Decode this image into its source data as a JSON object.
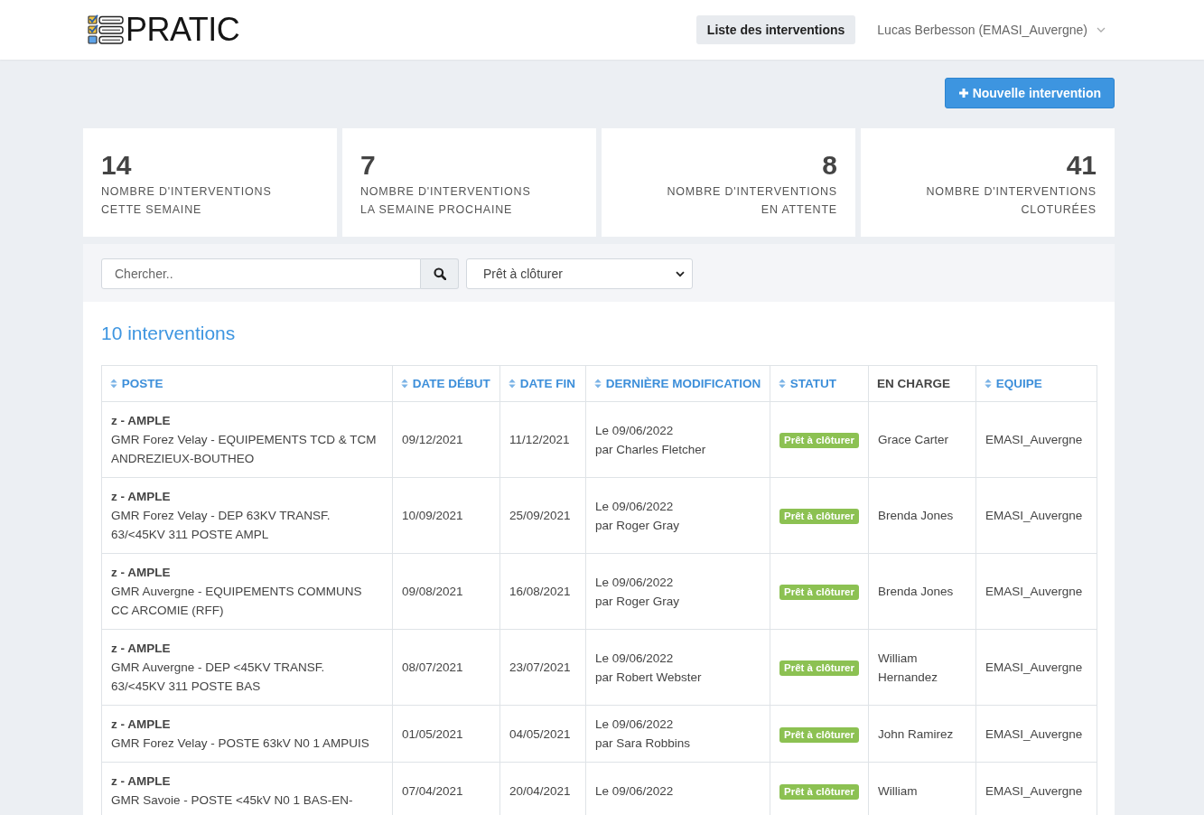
{
  "header": {
    "logo_text": "PRATIC",
    "nav_items": [
      {
        "label": "Liste des interventions",
        "selected": true
      }
    ],
    "user_menu": {
      "label": "Lucas Berbesson (EMASI_Auvergne)"
    }
  },
  "toolbar": {
    "new_button": "Nouvelle intervention"
  },
  "stats": [
    {
      "value": "14",
      "label": "NOMBRE D'INTERVENTIONS\nCETTE SEMAINE"
    },
    {
      "value": "7",
      "label": "NOMBRE D'INTERVENTIONS\nLA SEMAINE PROCHAINE"
    },
    {
      "value": "8",
      "label": "NOMBRE D'INTERVENTIONS\nEN ATTENTE"
    },
    {
      "value": "41",
      "label": "NOMBRE D'INTERVENTIONS\nCLOTURÉES"
    }
  ],
  "filters": {
    "search": {
      "placeholder": "Chercher.."
    },
    "status_select": {
      "value": "Prêt à clôturer"
    }
  },
  "table": {
    "title": "10 interventions",
    "columns": [
      {
        "label": "POSTE",
        "sortable": true
      },
      {
        "label": "DATE DÉBUT",
        "sortable": true
      },
      {
        "label": "DATE FIN",
        "sortable": true
      },
      {
        "label": "DERNIÈRE MODIFICATION",
        "sortable": true
      },
      {
        "label": "STATUT",
        "sortable": true
      },
      {
        "label": "EN CHARGE",
        "sortable": false
      },
      {
        "label": "EQUIPE",
        "sortable": true
      }
    ],
    "rows": [
      {
        "poste_code": "z - AMPLE",
        "poste_detail": "GMR Forez Velay - EQUIPEMENTS TCD & TCM ANDREZIEUX-BOUTHEO",
        "date_start": "09/12/2021",
        "date_end": "11/12/2021",
        "modified_date": "Le 09/06/2022",
        "modified_by": "par Charles Fletcher",
        "status": "Prêt à clôturer",
        "assignee": "Grace Carter",
        "team": "EMASI_Auvergne"
      },
      {
        "poste_code": "z - AMPLE",
        "poste_detail": "GMR Forez Velay - DEP 63KV TRANSF. 63/<45KV 311 POSTE AMPL",
        "date_start": "10/09/2021",
        "date_end": "25/09/2021",
        "modified_date": "Le 09/06/2022",
        "modified_by": "par Roger Gray",
        "status": "Prêt à clôturer",
        "assignee": "Brenda Jones",
        "team": "EMASI_Auvergne"
      },
      {
        "poste_code": "z - AMPLE",
        "poste_detail": "GMR Auvergne - EQUIPEMENTS COMMUNS CC ARCOMIE (RFF)",
        "date_start": "09/08/2021",
        "date_end": "16/08/2021",
        "modified_date": "Le 09/06/2022",
        "modified_by": "par Roger Gray",
        "status": "Prêt à clôturer",
        "assignee": "Brenda Jones",
        "team": "EMASI_Auvergne"
      },
      {
        "poste_code": "z - AMPLE",
        "poste_detail": "GMR Auvergne - DEP <45KV TRANSF. 63/<45KV 311 POSTE BAS",
        "date_start": "08/07/2021",
        "date_end": "23/07/2021",
        "modified_date": "Le 09/06/2022",
        "modified_by": "par Robert Webster",
        "status": "Prêt à clôturer",
        "assignee": "William Hernandez",
        "team": "EMASI_Auvergne"
      },
      {
        "poste_code": "z - AMPLE",
        "poste_detail": "GMR Forez Velay - POSTE 63kV N0 1 AMPUIS",
        "date_start": "01/05/2021",
        "date_end": "04/05/2021",
        "modified_date": "Le 09/06/2022",
        "modified_by": "par Sara Robbins",
        "status": "Prêt à clôturer",
        "assignee": "John Ramirez",
        "team": "EMASI_Auvergne"
      },
      {
        "poste_code": "z - AMPLE",
        "poste_detail": "GMR Savoie - POSTE <45kV N0 1 BAS-EN-",
        "date_start": "07/04/2021",
        "date_end": "20/04/2021",
        "modified_date": "Le 09/06/2022",
        "status": "Prêt à clôturer",
        "assignee": "William",
        "team": "EMASI_Auvergne"
      }
    ]
  }
}
